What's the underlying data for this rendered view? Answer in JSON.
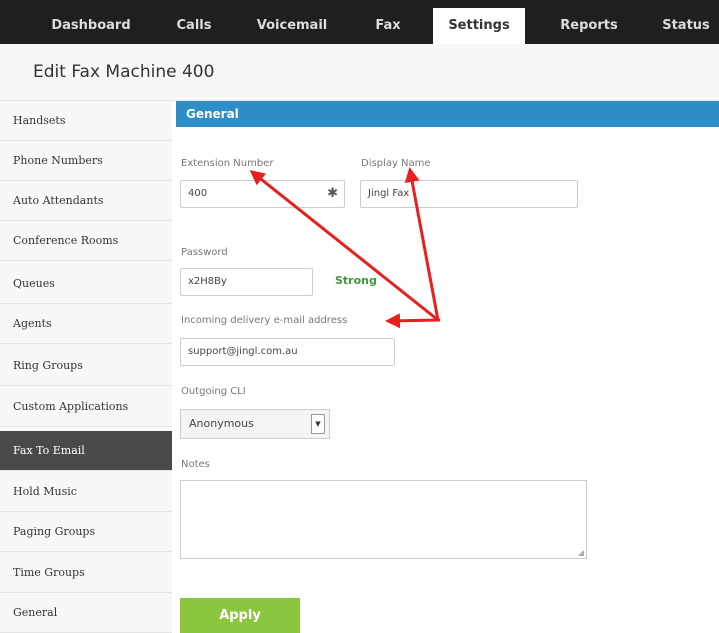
{
  "nav": {
    "tabs": [
      {
        "label": "Dashboard"
      },
      {
        "label": "Calls"
      },
      {
        "label": "Voicemail"
      },
      {
        "label": "Fax"
      },
      {
        "label": "Settings"
      },
      {
        "label": "Reports"
      },
      {
        "label": "Status"
      }
    ],
    "active": "Settings"
  },
  "page": {
    "title": "Edit Fax Machine 400"
  },
  "sidebar": {
    "items": [
      {
        "label": "Handsets"
      },
      {
        "label": "Phone Numbers"
      },
      {
        "label": "Auto Attendants"
      },
      {
        "label": "Conference Rooms"
      },
      {
        "label": "Queues"
      },
      {
        "label": "Agents"
      },
      {
        "label": "Ring Groups"
      },
      {
        "label": "Custom Applications"
      },
      {
        "label": "Fax To Email"
      },
      {
        "label": "Hold Music"
      },
      {
        "label": "Paging Groups"
      },
      {
        "label": "Time Groups"
      },
      {
        "label": "General"
      }
    ],
    "active": "Fax To Email"
  },
  "section": {
    "title": "General"
  },
  "form": {
    "extension": {
      "label": "Extension Number",
      "value": "400",
      "icon": "asterisk-icon"
    },
    "display_name": {
      "label": "Display Name",
      "value": "Jingl Fax"
    },
    "password": {
      "label": "Password",
      "value": "x2H8By",
      "strength": "Strong"
    },
    "email": {
      "label": "Incoming delivery e-mail address",
      "value": "support@jingl.com.au"
    },
    "outgoing_cli": {
      "label": "Outgoing CLI",
      "value": "Anonymous"
    },
    "notes": {
      "label": "Notes",
      "value": ""
    },
    "apply_label": "Apply"
  },
  "colors": {
    "nav_bg": "#1f1f1f",
    "section_bar": "#2e8fc8",
    "apply": "#8cc63f",
    "strength": "#3a9b3a",
    "annotation_arrow": "#e8201d"
  }
}
